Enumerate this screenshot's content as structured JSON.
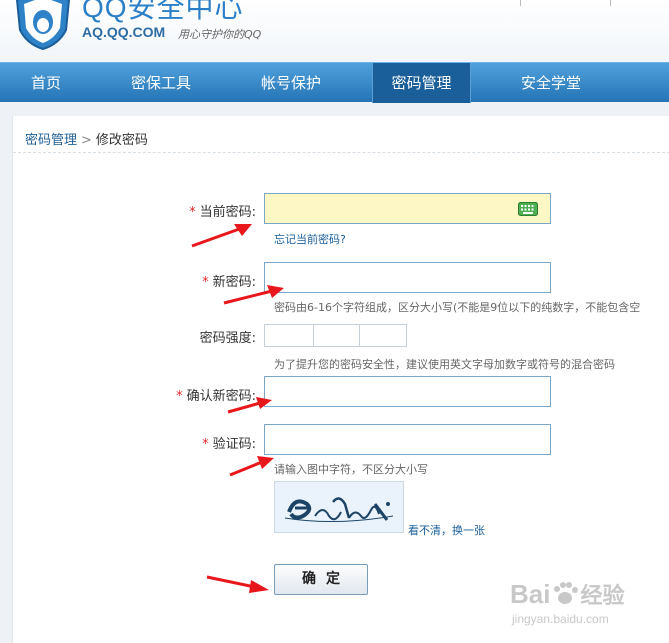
{
  "header": {
    "brand_title": "QQ安全中心",
    "brand_domain": "AQ.QQ.COM",
    "brand_slogan": "用心守护你的QQ"
  },
  "nav": {
    "items": [
      {
        "label": "首页"
      },
      {
        "label": "密保工具"
      },
      {
        "label": "帐号保护"
      },
      {
        "label": "密码管理"
      },
      {
        "label": "安全学堂"
      }
    ],
    "active_index": 3
  },
  "breadcrumb": {
    "parent": "密码管理",
    "separator": ">",
    "current": "修改密码"
  },
  "form": {
    "required_mark": "*",
    "current_password": {
      "label": "当前密码:",
      "forgot_link": "忘记当前密码?"
    },
    "new_password": {
      "label": "新密码:",
      "hint": "密码由6-16个字符组成，区分大小写(不能是9位以下的纯数字，不能包含空"
    },
    "strength": {
      "label": "密码强度:",
      "hint": "为了提升您的密码安全性，建议使用英文字母加数字或符号的混合密码"
    },
    "confirm_password": {
      "label": "确认新密码:"
    },
    "captcha": {
      "label": "验证码:",
      "hint": "请输入图中字符，不区分大小写",
      "refresh_link": "看不清，换一张"
    },
    "submit_label": "确定"
  },
  "watermark": {
    "brand": "Bai",
    "brand_suffix": "经验",
    "site": "jingyan.baidu.com"
  },
  "colors": {
    "nav_blue": "#2574b6",
    "active_nav": "#1a5f9a",
    "required_red": "#e0282c",
    "arrow_red": "#e8171c",
    "field_yellow": "#fdf7c6"
  }
}
